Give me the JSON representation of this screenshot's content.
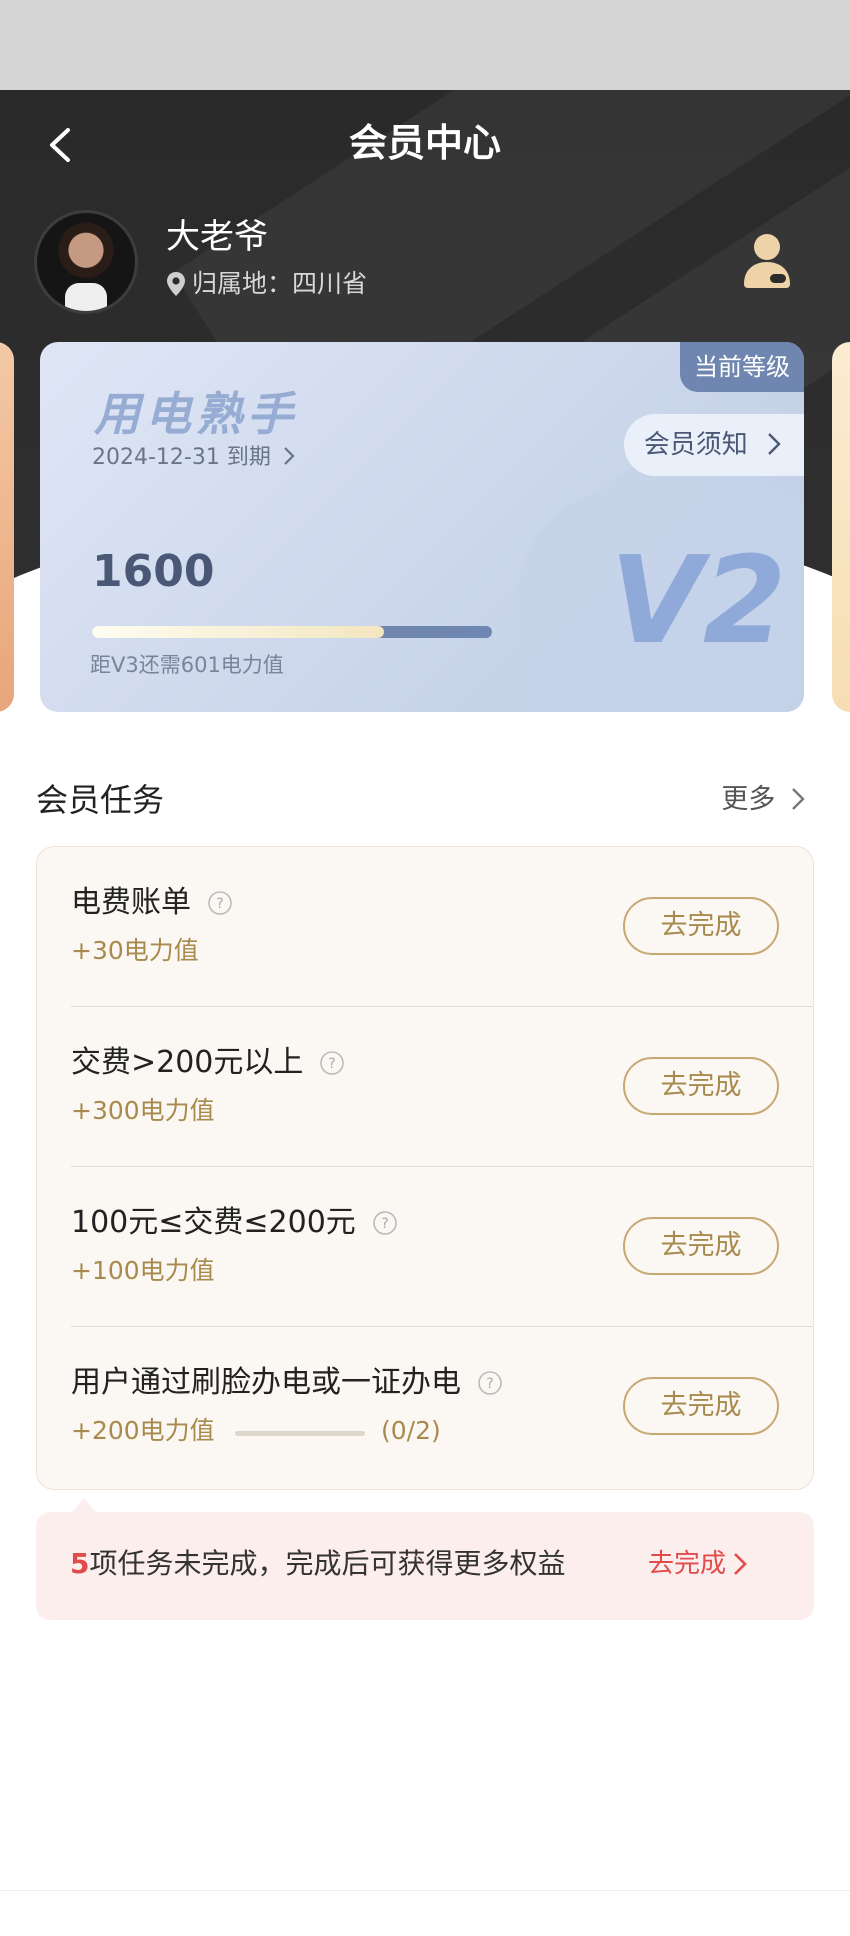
{
  "header": {
    "title": "会员中心",
    "back_icon": "chevron-left-icon",
    "profile_icon": "user-icon"
  },
  "user": {
    "name": "大老爷",
    "location_label": "归属地：四川省",
    "location_icon": "location-pin-icon"
  },
  "level_card": {
    "badge": "当前等级",
    "level_name": "用电熟手",
    "expire": "2024-12-31 到期",
    "notice_button": "会员须知",
    "level_mark": "V2",
    "points": "1600",
    "progress": 0.73,
    "hint": "距V3还需601电力值"
  },
  "tasks": {
    "title": "会员任务",
    "more": "更多",
    "items": [
      {
        "name": "电费账单",
        "reward": "+30电力值",
        "button": "去完成"
      },
      {
        "name": "交费>200元以上",
        "reward": "+300电力值",
        "button": "去完成"
      },
      {
        "name": "100元≤交费≤200元",
        "reward": "+100电力值",
        "button": "去完成"
      },
      {
        "name": "用户通过刷脸办电或一证办电",
        "reward": "+200电力值",
        "progress_text": "(0/2)",
        "progress": 0,
        "button": "去完成"
      }
    ]
  },
  "tip": {
    "count": "5",
    "text": "项任务未完成，完成后可获得更多权益",
    "link": "去完成"
  },
  "colors": {
    "header_bg": "#2c2c2c",
    "gold": "#a98a4e",
    "alert_red": "#e24b4b",
    "level_blue": "#6f86b0"
  }
}
